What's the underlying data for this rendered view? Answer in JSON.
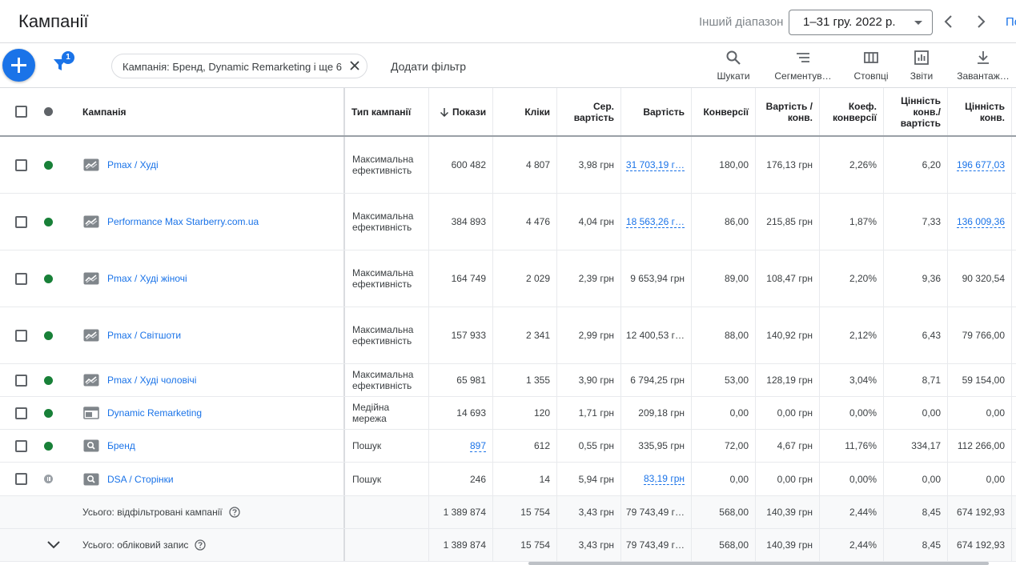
{
  "header": {
    "title": "Кампанії",
    "range_label": "Інший діапазон",
    "date_range": "1–31 гру. 2022 р.",
    "cut_link": "По"
  },
  "toolbar": {
    "filter_count": "1",
    "filter_chip": "Кампанія: Бренд, Dynamic Remarketing і ще 6",
    "add_filter": "Додати фільтр",
    "tools": [
      {
        "label": "Шукати",
        "icon": "search-icon"
      },
      {
        "label": "Сегментув…",
        "icon": "segment-icon"
      },
      {
        "label": "Стовпці",
        "icon": "columns-icon"
      },
      {
        "label": "Звіти",
        "icon": "reports-icon"
      },
      {
        "label": "Завантаж…",
        "icon": "download-icon"
      }
    ]
  },
  "columns": {
    "campaign": "Кампанія",
    "type": "Тип кампанії",
    "impressions": "Покази",
    "clicks": "Кліки",
    "avg_cost_1": "Сер.",
    "avg_cost_2": "вартість",
    "cost": "Вартість",
    "conversions": "Конверсії",
    "cost_conv_1": "Вартість /",
    "cost_conv_2": "конв.",
    "conv_rate_1": "Коеф.",
    "conv_rate_2": "конверсії",
    "value_cost_1": "Цінність",
    "value_cost_2": "конв./",
    "value_cost_3": "вартість",
    "conv_value_1": "Цінність",
    "conv_value_2": "конв."
  },
  "rows": [
    {
      "status": "enabled",
      "icon": "performance-max-icon",
      "name": "Pmax / Худі",
      "type1": "Максимальна",
      "type2": "ефективність",
      "impressions": "600 482",
      "clicks": "4 807",
      "avg_cost": "3,98 грн",
      "cost": "31 703,19 г…",
      "conversions": "180,00",
      "cost_conv": "176,13 грн",
      "conv_rate": "2,26%",
      "value_cost": "6,20",
      "conv_value": "196 677,03"
    },
    {
      "status": "enabled",
      "icon": "performance-max-icon",
      "name": "Performance Max Starberry.com.ua",
      "type1": "Максимальна",
      "type2": "ефективність",
      "impressions": "384 893",
      "clicks": "4 476",
      "avg_cost": "4,04 грн",
      "cost": "18 563,26 г…",
      "conversions": "86,00",
      "cost_conv": "215,85 грн",
      "conv_rate": "1,87%",
      "value_cost": "7,33",
      "conv_value": "136 009,36"
    },
    {
      "status": "enabled",
      "icon": "performance-max-icon",
      "name": "Pmax / Худі жіночі",
      "type1": "Максимальна",
      "type2": "ефективність",
      "impressions": "164 749",
      "clicks": "2 029",
      "avg_cost": "2,39 грн",
      "cost": "9 653,94 грн",
      "conversions": "89,00",
      "cost_conv": "108,47 грн",
      "conv_rate": "2,20%",
      "value_cost": "9,36",
      "conv_value": "90 320,54"
    },
    {
      "status": "enabled",
      "icon": "performance-max-icon",
      "name": "Pmax / Світшоти",
      "type1": "Максимальна",
      "type2": "ефективність",
      "impressions": "157 933",
      "clicks": "2 341",
      "avg_cost": "2,99 грн",
      "cost": "12 400,53 г…",
      "conversions": "88,00",
      "cost_conv": "140,92 грн",
      "conv_rate": "2,12%",
      "value_cost": "6,43",
      "conv_value": "79 766,00"
    },
    {
      "status": "enabled",
      "icon": "performance-max-icon",
      "name": "Pmax / Худі чоловічі",
      "type1": "Максимальна",
      "type2": "ефективність",
      "impressions": "65 981",
      "clicks": "1 355",
      "avg_cost": "3,90 грн",
      "cost": "6 794,25 грн",
      "conversions": "53,00",
      "cost_conv": "128,19 грн",
      "conv_rate": "3,04%",
      "value_cost": "8,71",
      "conv_value": "59 154,00"
    },
    {
      "status": "enabled",
      "icon": "display-icon",
      "name": "Dynamic Remarketing",
      "type1": "Медійна",
      "type2": "мережа",
      "impressions": "14 693",
      "clicks": "120",
      "avg_cost": "1,71 грн",
      "cost": "209,18 грн",
      "conversions": "0,00",
      "cost_conv": "0,00 грн",
      "conv_rate": "0,00%",
      "value_cost": "0,00",
      "conv_value": "0,00"
    },
    {
      "status": "enabled",
      "icon": "search-campaign-icon",
      "name": "Бренд",
      "type1": "Пошук",
      "type2": "",
      "impressions": "897",
      "clicks": "612",
      "avg_cost": "0,55 грн",
      "cost": "335,95 грн",
      "conversions": "72,00",
      "cost_conv": "4,67 грн",
      "conv_rate": "11,76%",
      "value_cost": "334,17",
      "conv_value": "112 266,00"
    },
    {
      "status": "paused",
      "icon": "search-campaign-icon",
      "name": "DSA / Сторінки",
      "type1": "Пошук",
      "type2": "",
      "impressions": "246",
      "clicks": "14",
      "avg_cost": "5,94 грн",
      "cost": "83,19 грн",
      "conversions": "0,00",
      "cost_conv": "0,00 грн",
      "conv_rate": "0,00%",
      "value_cost": "0,00",
      "conv_value": "0,00"
    }
  ],
  "totals": [
    {
      "label": "Усього: відфільтровані кампанії",
      "impressions": "1 389 874",
      "clicks": "15 754",
      "avg_cost": "3,43 грн",
      "cost": "79 743,49 г…",
      "conversions": "568,00",
      "cost_conv": "140,39 грн",
      "conv_rate": "2,44%",
      "value_cost": "8,45",
      "conv_value": "674 192,93"
    },
    {
      "label": "Усього: обліковий запис",
      "impressions": "1 389 874",
      "clicks": "15 754",
      "avg_cost": "3,43 грн",
      "cost": "79 743,49 г…",
      "conversions": "568,00",
      "cost_conv": "140,39 грн",
      "conv_rate": "2,44%",
      "value_cost": "8,45",
      "conv_value": "674 192,93"
    }
  ]
}
